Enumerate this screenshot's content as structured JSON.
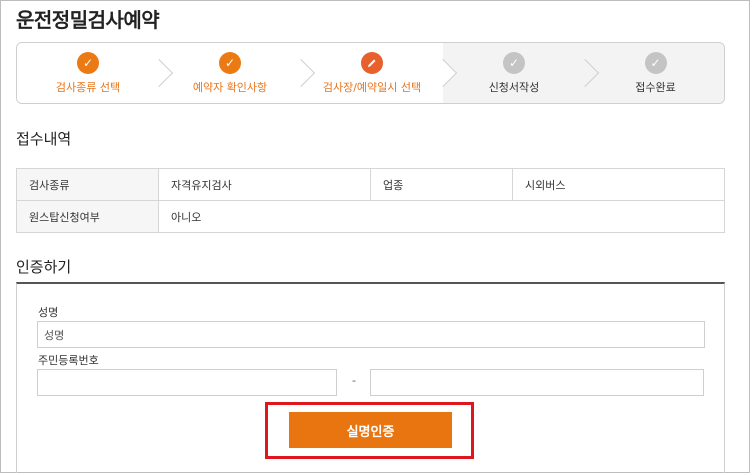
{
  "page": {
    "title": "운전정밀검사예약"
  },
  "stepper": {
    "steps": [
      {
        "label": "검사종류 선택",
        "state": "done",
        "icon": "check-icon"
      },
      {
        "label": "예약자 확인사항",
        "state": "done",
        "icon": "check-icon"
      },
      {
        "label": "검사장/예약일시 선택",
        "state": "current",
        "icon": "pencil-icon"
      },
      {
        "label": "신청서작성",
        "state": "todo",
        "icon": "check-icon"
      },
      {
        "label": "접수완료",
        "state": "todo",
        "icon": "check-icon"
      }
    ],
    "colors": {
      "active": "#ec7a14",
      "inactive": "#c4c4c4"
    }
  },
  "receipt": {
    "title": "접수내역",
    "rows": [
      [
        "검사종류",
        "자격유지검사",
        "업종",
        "시외버스"
      ],
      [
        "원스탑신청여부",
        "아니오"
      ]
    ]
  },
  "auth": {
    "title": "인증하기",
    "name_label": "성명",
    "name_placeholder": "성명",
    "rrn_label": "주민등록번호",
    "rrn_separator": "-",
    "submit_label": "실명인증",
    "button_color": "#e8750f",
    "highlight_color": "#e0161e"
  }
}
